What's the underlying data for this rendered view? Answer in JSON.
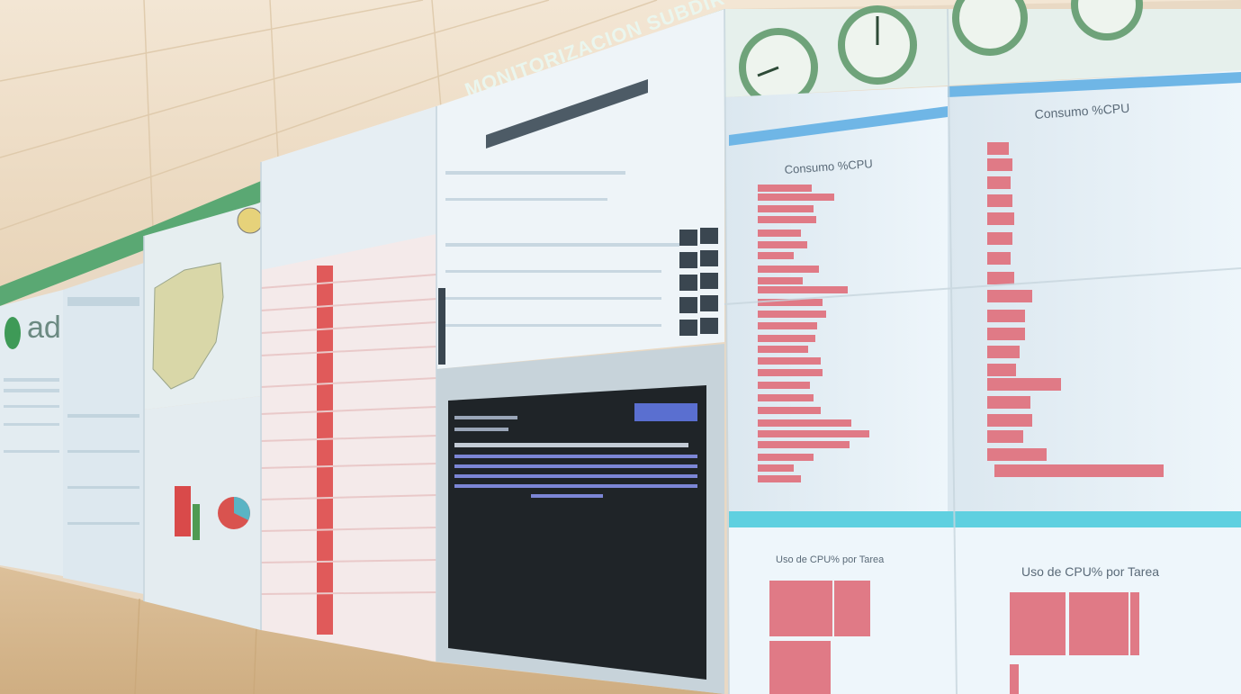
{
  "banner": {
    "text": "MONITORIZACION SUBDIR"
  },
  "logo": {
    "text": "adif"
  },
  "panels": {
    "cpu_left": {
      "title": "Consumo %CPU"
    },
    "cpu_right": {
      "title": "Consumo %CPU"
    },
    "task_left": {
      "title": "Uso de CPU% por Tarea"
    },
    "task_right": {
      "title": "Uso de CPU% por Tarea"
    }
  },
  "colors": {
    "bar": "#e07a86",
    "ceiling": "#efe0cc",
    "floor": "#d9b98d",
    "banner": "#5aa873",
    "terminal": "#1f2428"
  }
}
